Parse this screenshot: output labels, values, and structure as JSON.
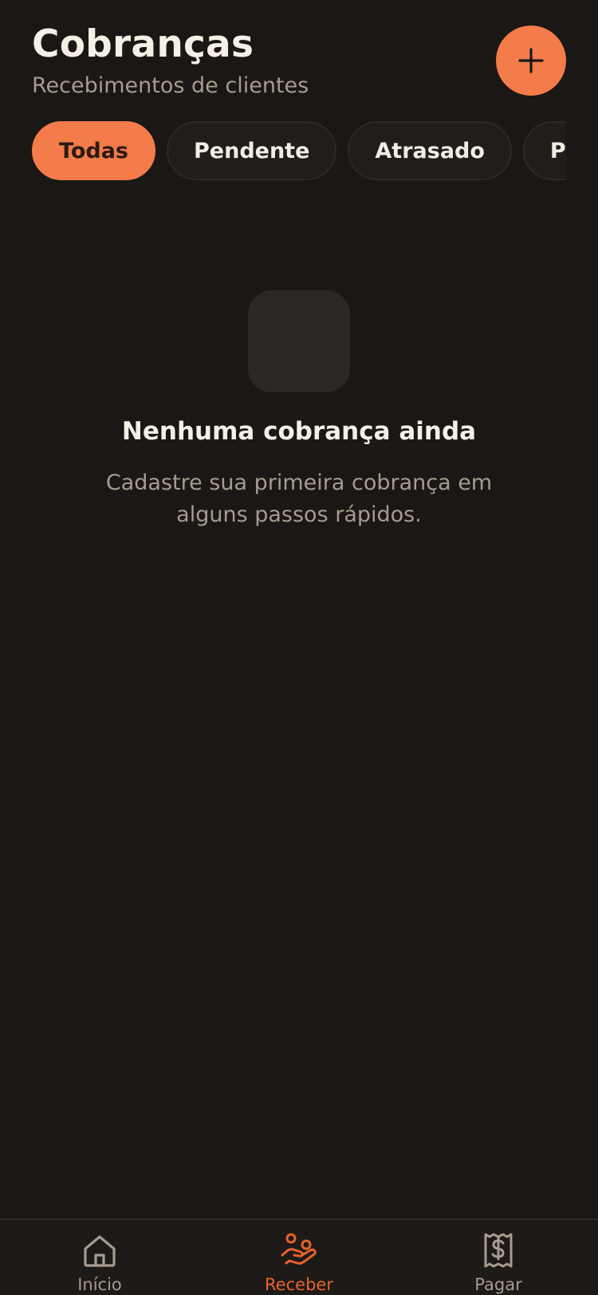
{
  "header": {
    "title": "Cobranças",
    "subtitle": "Recebimentos de clientes",
    "add_icon": "plus-icon"
  },
  "filters": [
    {
      "label": "Todas",
      "active": true
    },
    {
      "label": "Pendente",
      "active": false
    },
    {
      "label": "Atrasado",
      "active": false
    },
    {
      "label": "Pago",
      "active": false
    }
  ],
  "empty_state": {
    "title": "Nenhuma cobrança ainda",
    "description": "Cadastre sua primeira cobrança em alguns passos rápidos."
  },
  "tabbar": {
    "items": [
      {
        "label": "Início",
        "icon": "home-icon",
        "active": false
      },
      {
        "label": "Receber",
        "icon": "receive-money-icon",
        "active": true
      },
      {
        "label": "Pagar",
        "icon": "receipt-icon",
        "active": false
      }
    ]
  },
  "colors": {
    "background": "#1a1714",
    "accent": "#f47c4a",
    "active_tab": "#e8622e",
    "muted_text": "#a89b8f"
  }
}
